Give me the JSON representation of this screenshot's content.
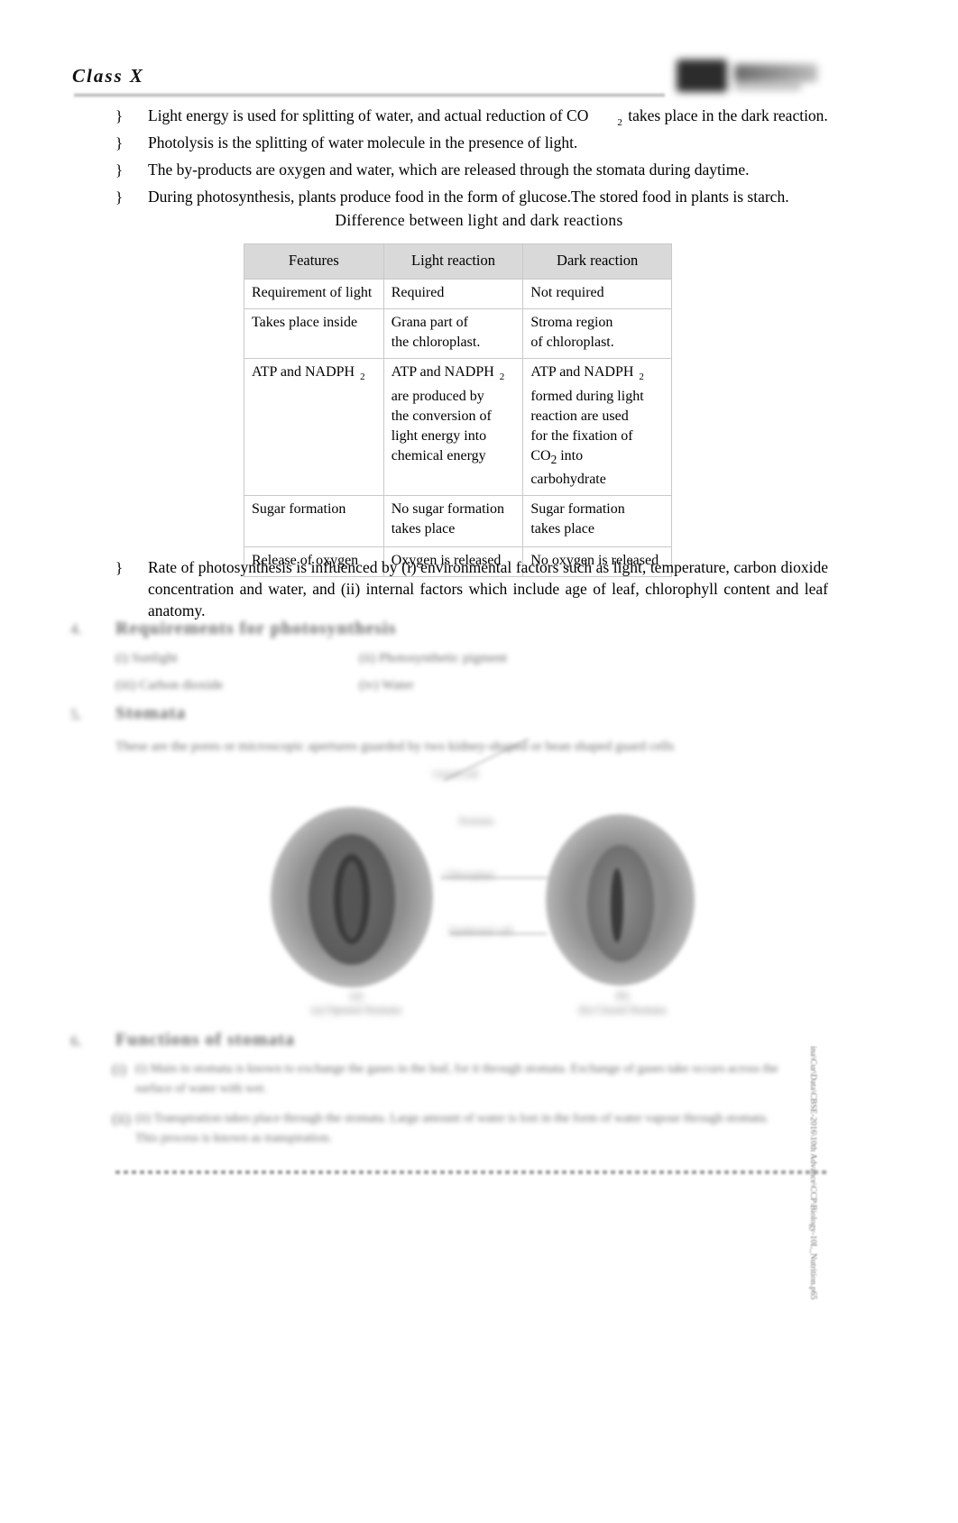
{
  "header": {
    "class_label": "Class X",
    "logo_name": "publisher-logo"
  },
  "bullets": [
    {
      "mark": "}",
      "text_before_sub": "Light energy is used for splitting of water, and actual reduction of CO",
      "subscript": "2",
      "text_after_sub": "takes place in the dark reaction."
    },
    {
      "mark": "}",
      "text": "Photolysis is the splitting of water molecule in the presence of light."
    },
    {
      "mark": "}",
      "text": "The by-products are oxygen and water, which are released through the stomata during daytime."
    },
    {
      "mark": "}",
      "text": "During photosynthesis, plants produce food in the form of glucose.The stored food in plants is starch."
    }
  ],
  "table": {
    "caption": "Difference between light and dark reactions",
    "headers": [
      "Features",
      "Light reaction",
      "Dark reaction"
    ],
    "rows": [
      {
        "feature": "Requirement of light",
        "light": "Required",
        "dark": "Not required"
      },
      {
        "feature": "Takes place inside",
        "light": "Grana part of\nthe chloroplast.",
        "dark": "Stroma region\nof chloroplast."
      },
      {
        "feature": "ATP and NADPH",
        "feature_sub": "2",
        "light": "ATP and NADPH",
        "light_sub": "2",
        "light_rest": "are produced by\nthe conversion of\nlight energy into\nchemical energy",
        "dark": "ATP and NADPH",
        "dark_sub": "2",
        "dark_rest": "formed during light\nreaction are used\nfor the fixation of",
        "dark_co2_pre": "CO",
        "dark_co2_sub": "2",
        "dark_co2_post": " into",
        "dark_last": "carbohydrate"
      },
      {
        "feature": "Sugar formation",
        "light": "No sugar formation\ntakes place",
        "dark": "Sugar formation\ntakes place"
      },
      {
        "feature": "Release of oxygen",
        "light": "Oxygen is released",
        "dark": "No oxygen is released"
      }
    ]
  },
  "rate_bullet": {
    "mark": "}",
    "text": "Rate of photosynthesis is influenced by (i) environmental factors such as light, temperature, carbon dioxide concentration and water, and (ii) internal factors which include age of leaf, chlorophyll content and leaf anatomy."
  },
  "blurred_sections": [
    {
      "number": "4.",
      "heading": "Requirements for photosynthesis",
      "lines": [
        {
          "left": "(i) Sunlight",
          "right": "(ii) Photosynthetic pigment"
        },
        {
          "left": "(iii) Carbon dioxide",
          "right": "(iv) Water"
        }
      ]
    },
    {
      "number": "5.",
      "heading": "Stomata",
      "lines": [
        {
          "left": "These are the pores or microscopic apertures guarded by two kidney-shaped or bean shaped guard cells"
        }
      ]
    },
    {
      "number": "6.",
      "heading": "Functions of stomata",
      "items": [
        "(i)  Main in stomata is known to exchange the gases in the leaf, for it through stomata. Exchange of gases take occurs across the surface of water with wet.",
        "(ii) Transpiration takes place through the stomata. Large amount of water is lost in the form of water vapour through stomata. This process is known as transpiration."
      ]
    }
  ],
  "diagram": {
    "label_top": "Guard cell",
    "labels": [
      "Stomata",
      "Chloroplast",
      "Epidermal cell"
    ],
    "caption_left_line1": "(a)",
    "caption_left_line2": "(a) Opened Stomata",
    "caption_right_line1": "(b)",
    "caption_right_line2": "(b) Closed Stomata"
  },
  "side_path": "ina\\Cur\\Data\\CBSE-2016\\10th Advance\\CCP\\Biology-10L_Nutrition.p65",
  "colors": {
    "header_band": "#d9d9d9",
    "table_border": "#c9c9c9",
    "blurred_text": "#6d6d6d"
  }
}
